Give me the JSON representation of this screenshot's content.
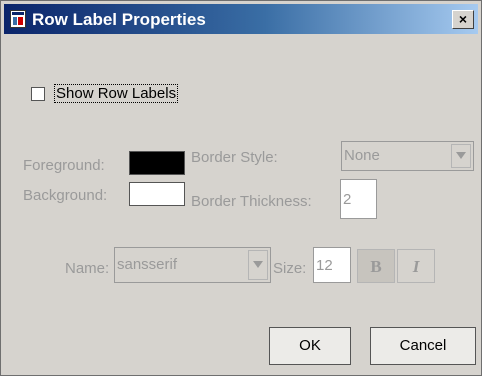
{
  "window": {
    "title": "Row Label Properties",
    "close_glyph": "×",
    "icon": "dialog-app-icon"
  },
  "show_row_labels": {
    "label": "Show Row Labels",
    "checked": false
  },
  "labels": {
    "foreground": "Foreground:",
    "background": "Background:",
    "border_style": "Border Style:",
    "border_thickness": "Border Thickness:",
    "name": "Name:",
    "size": "Size:"
  },
  "values": {
    "foreground_color": "#000000",
    "background_color": "#ffffff",
    "border_style": "None",
    "border_thickness": "2",
    "font_name": "sansserif",
    "font_size": "12"
  },
  "style_buttons": {
    "bold": "B",
    "italic": "I"
  },
  "buttons": {
    "ok": "OK",
    "cancel": "Cancel"
  },
  "colors": {
    "titlebar_start": "#0a246a",
    "titlebar_end": "#a6caf0",
    "dialog_bg": "#d6d3ce",
    "disabled_text": "#9a9a9a"
  }
}
